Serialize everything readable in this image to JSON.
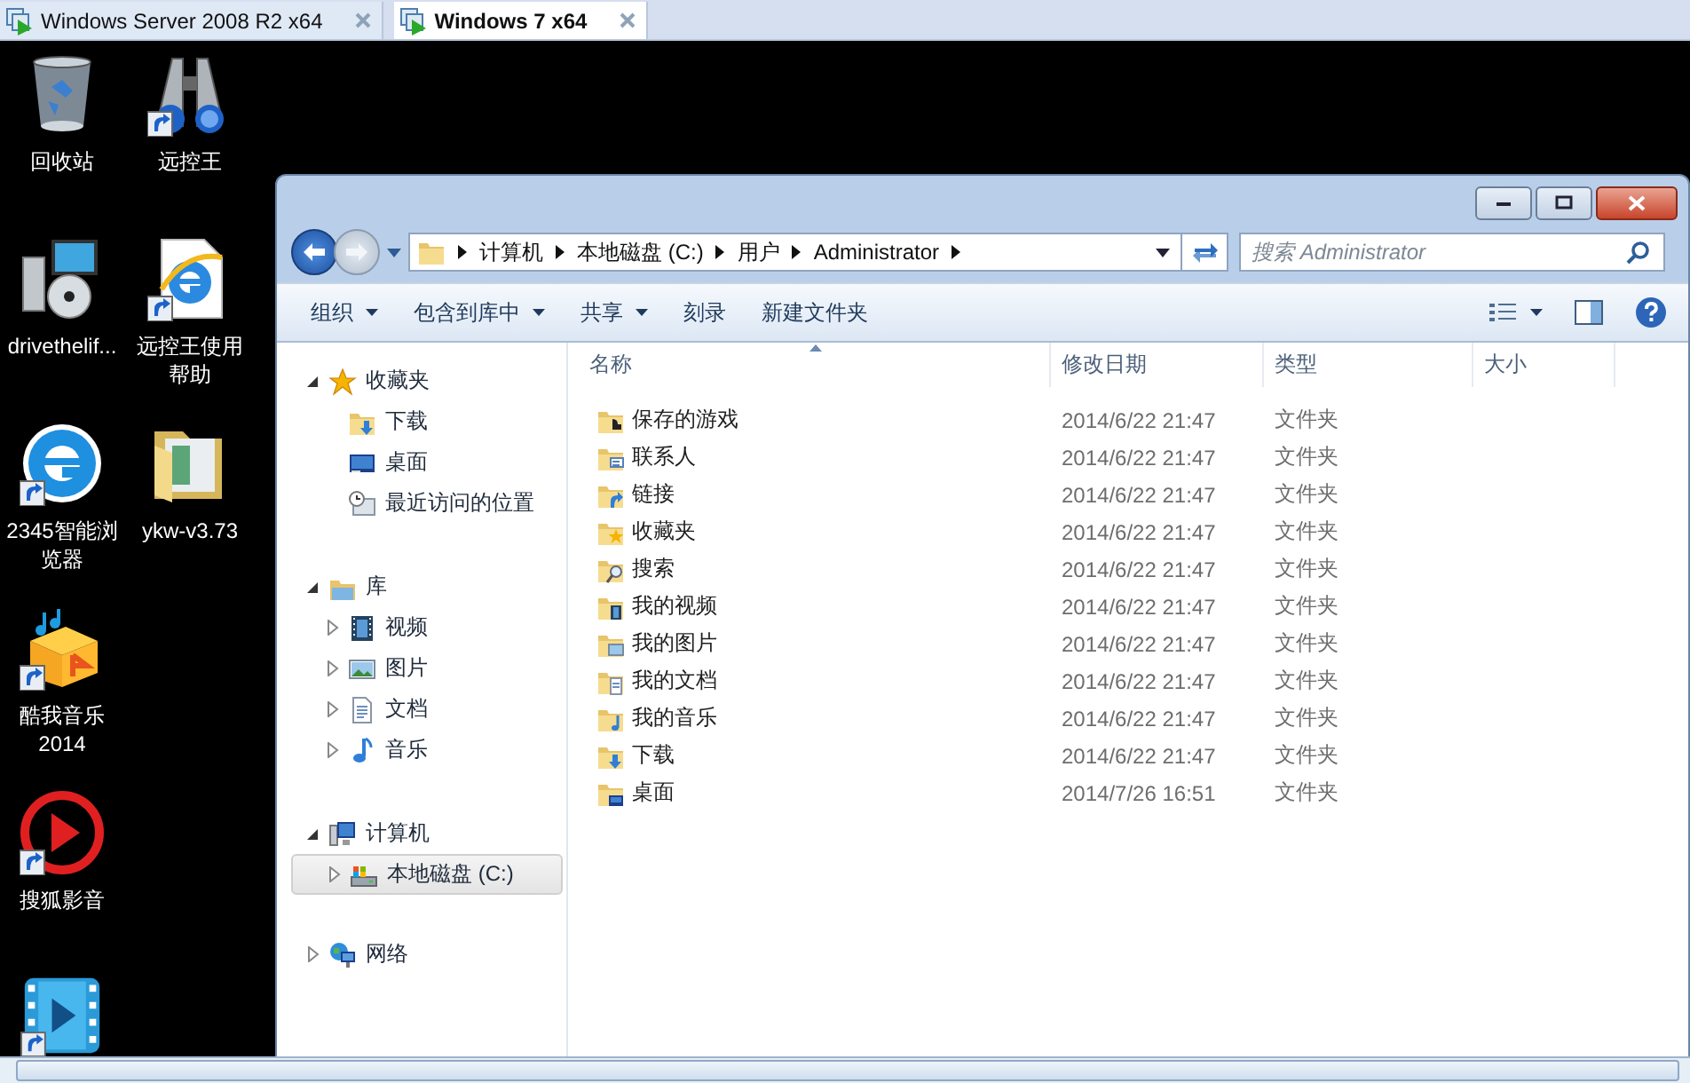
{
  "vm_tabs": [
    {
      "label": "Windows Server 2008 R2 x64",
      "selected": false
    },
    {
      "label": "Windows 7 x64",
      "selected": true
    }
  ],
  "desktop_icons": [
    {
      "label": "回收站",
      "kind": "recycle-bin"
    },
    {
      "label": "drivethelif...",
      "kind": "installer"
    },
    {
      "label": "2345智能浏览器",
      "kind": "browser"
    },
    {
      "label": "酷我音乐2014",
      "kind": "music-box"
    },
    {
      "label": "搜狐影音",
      "kind": "player"
    },
    {
      "kind": "video"
    },
    {
      "label": "远控王",
      "kind": "binoculars"
    },
    {
      "label": "远控王使用帮助",
      "kind": "web-document"
    },
    {
      "label": "ykw-v3.73",
      "kind": "folder"
    }
  ],
  "explorer": {
    "breadcrumb": [
      "计算机",
      "本地磁盘 (C:)",
      "用户",
      "Administrator"
    ],
    "search": {
      "placeholder": "搜索 Administrator"
    },
    "toolbar": [
      {
        "label": "组织",
        "dropdown": true
      },
      {
        "label": "包含到库中",
        "dropdown": true
      },
      {
        "label": "共享",
        "dropdown": true
      },
      {
        "label": "刻录",
        "dropdown": false
      },
      {
        "label": "新建文件夹",
        "dropdown": false
      }
    ],
    "nav": [
      {
        "label": "收藏夹",
        "kind": "star",
        "expanded": true,
        "children": [
          {
            "label": "下载",
            "kind": "download",
            "selected": false
          },
          {
            "label": "桌面",
            "kind": "desktop",
            "selected": false
          },
          {
            "label": "最近访问的位置",
            "kind": "recent",
            "selected": false
          }
        ]
      },
      {
        "label": "库",
        "kind": "library",
        "expanded": true,
        "children": [
          {
            "label": "视频",
            "kind": "video",
            "selected": false,
            "expanded": false
          },
          {
            "label": "图片",
            "kind": "picture",
            "selected": false,
            "expanded": false
          },
          {
            "label": "文档",
            "kind": "document",
            "selected": false,
            "expanded": false
          },
          {
            "label": "音乐",
            "kind": "music",
            "selected": false,
            "expanded": false
          }
        ]
      },
      {
        "label": "计算机",
        "kind": "computer",
        "expanded": true,
        "children": [
          {
            "label": "本地磁盘 (C:)",
            "kind": "drive",
            "selected": true,
            "expanded": false
          }
        ]
      },
      {
        "label": "网络",
        "kind": "network",
        "expanded": false
      }
    ],
    "columns": [
      {
        "label": "名称",
        "sorted": true
      },
      {
        "label": "修改日期",
        "sorted": false
      },
      {
        "label": "类型",
        "sorted": false
      },
      {
        "label": "大小",
        "sorted": false
      }
    ],
    "rows": [
      {
        "name": "保存的游戏",
        "date": "2014/6/22 21:47",
        "type": "文件夹",
        "kind": "game"
      },
      {
        "name": "联系人",
        "date": "2014/6/22 21:47",
        "type": "文件夹",
        "kind": "contact"
      },
      {
        "name": "链接",
        "date": "2014/6/22 21:47",
        "type": "文件夹",
        "kind": "link"
      },
      {
        "name": "收藏夹",
        "date": "2014/6/22 21:47",
        "type": "文件夹",
        "kind": "star"
      },
      {
        "name": "搜索",
        "date": "2014/6/22 21:47",
        "type": "文件夹",
        "kind": "search"
      },
      {
        "name": "我的视频",
        "date": "2014/6/22 21:47",
        "type": "文件夹",
        "kind": "video"
      },
      {
        "name": "我的图片",
        "date": "2014/6/22 21:47",
        "type": "文件夹",
        "kind": "picture"
      },
      {
        "name": "我的文档",
        "date": "2014/6/22 21:47",
        "type": "文件夹",
        "kind": "document"
      },
      {
        "name": "我的音乐",
        "date": "2014/6/22 21:47",
        "type": "文件夹",
        "kind": "music"
      },
      {
        "name": "下载",
        "date": "2014/6/22 21:47",
        "type": "文件夹",
        "kind": "download"
      },
      {
        "name": "桌面",
        "date": "2014/7/26 16:51",
        "type": "文件夹",
        "kind": "desktop"
      }
    ]
  }
}
